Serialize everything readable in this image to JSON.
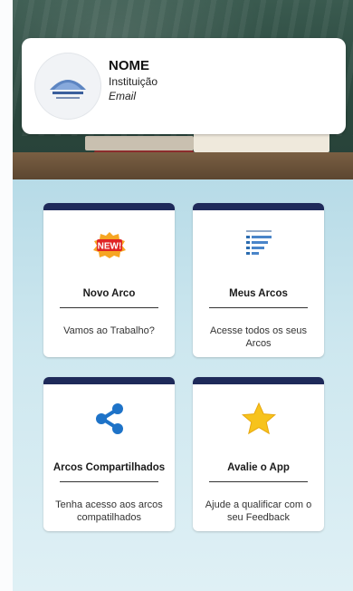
{
  "profile": {
    "name": "NOME",
    "institution": "Instituição",
    "email": "Email"
  },
  "tiles": [
    {
      "title": "Novo Arco",
      "description": "Vamos ao Trabalho?",
      "icon": "new-badge-icon"
    },
    {
      "title": "Meus Arcos",
      "description": "Acesse todos os seus Arcos",
      "icon": "list-icon"
    },
    {
      "title": "Arcos Compartilhados",
      "description": "Tenha acesso aos arcos compatilhados",
      "icon": "share-icon"
    },
    {
      "title": "Avalie o App",
      "description": "Ajude a qualificar com o seu Feedback",
      "icon": "star-icon"
    }
  ],
  "badge_text": "NEW!",
  "colors": {
    "tile_accent": "#1e2a5a",
    "share_blue": "#1e73c8",
    "star_yellow": "#f7c31c",
    "badge_red": "#e02424",
    "background": "#cde7ef"
  }
}
